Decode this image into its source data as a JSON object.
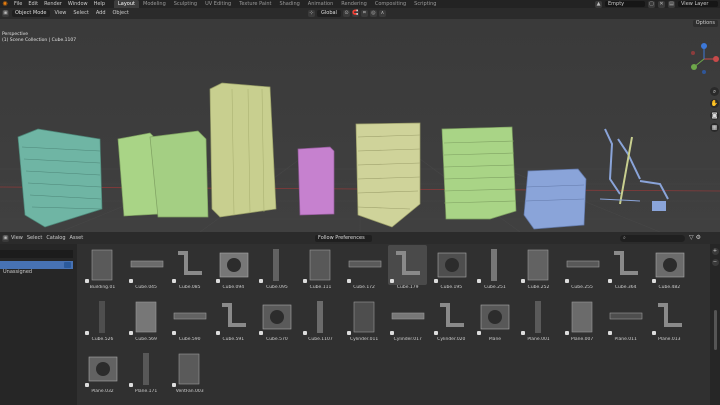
{
  "topbar": {
    "menus": [
      "File",
      "Edit",
      "Render",
      "Window",
      "Help"
    ],
    "workspaces": [
      "Layout",
      "Modeling",
      "Sculpting",
      "UV Editing",
      "Texture Paint",
      "Shading",
      "Animation",
      "Rendering",
      "Compositing",
      "Scripting"
    ],
    "active_workspace": "Layout",
    "scene": "Empty",
    "view_layer": "View Layer"
  },
  "viewport_header": {
    "mode": "Object Mode",
    "menus": [
      "View",
      "Select",
      "Add",
      "Object"
    ],
    "orientation": "Global",
    "options": "Options"
  },
  "viewport": {
    "view_name": "Perspective",
    "collection_info": "(1) Scene Collection | Cube.1107"
  },
  "asset_browser": {
    "menus": [
      "View",
      "Select",
      "Catalog",
      "Asset"
    ],
    "import_method": "Follow Preferences",
    "search_placeholder": "",
    "library_selected": "",
    "unassigned_label": "Unassigned",
    "assets": [
      "Building.01",
      "Cube.045",
      "Cube.085",
      "Cube.094",
      "Cube.095",
      "Cube.111",
      "Cube.172",
      "Cube.179",
      "Cube.195",
      "Cube.251",
      "Cube.252",
      "Cube.255",
      "Cube.364",
      "Cube.482",
      "Cube.526",
      "Cube.569",
      "Cube.590",
      "Cube.591",
      "Cube.570",
      "Cube.1107",
      "Cylinder.011",
      "Cylinder.017",
      "Cylinder.020",
      "Plane",
      "Plane.001",
      "Plane.007",
      "Plane.011",
      "Plane.013",
      "Plane.032",
      "Plane.171",
      "VentFan.003"
    ],
    "highlighted_asset": "Cube.179"
  },
  "colors": {
    "teal": "#6fb5a4",
    "green": "#a9d486",
    "khaki": "#c8cf8f",
    "pink": "#c681cf",
    "blue": "#8aa4d9",
    "selection": "#4772b3",
    "accent": "#e87d0d"
  }
}
